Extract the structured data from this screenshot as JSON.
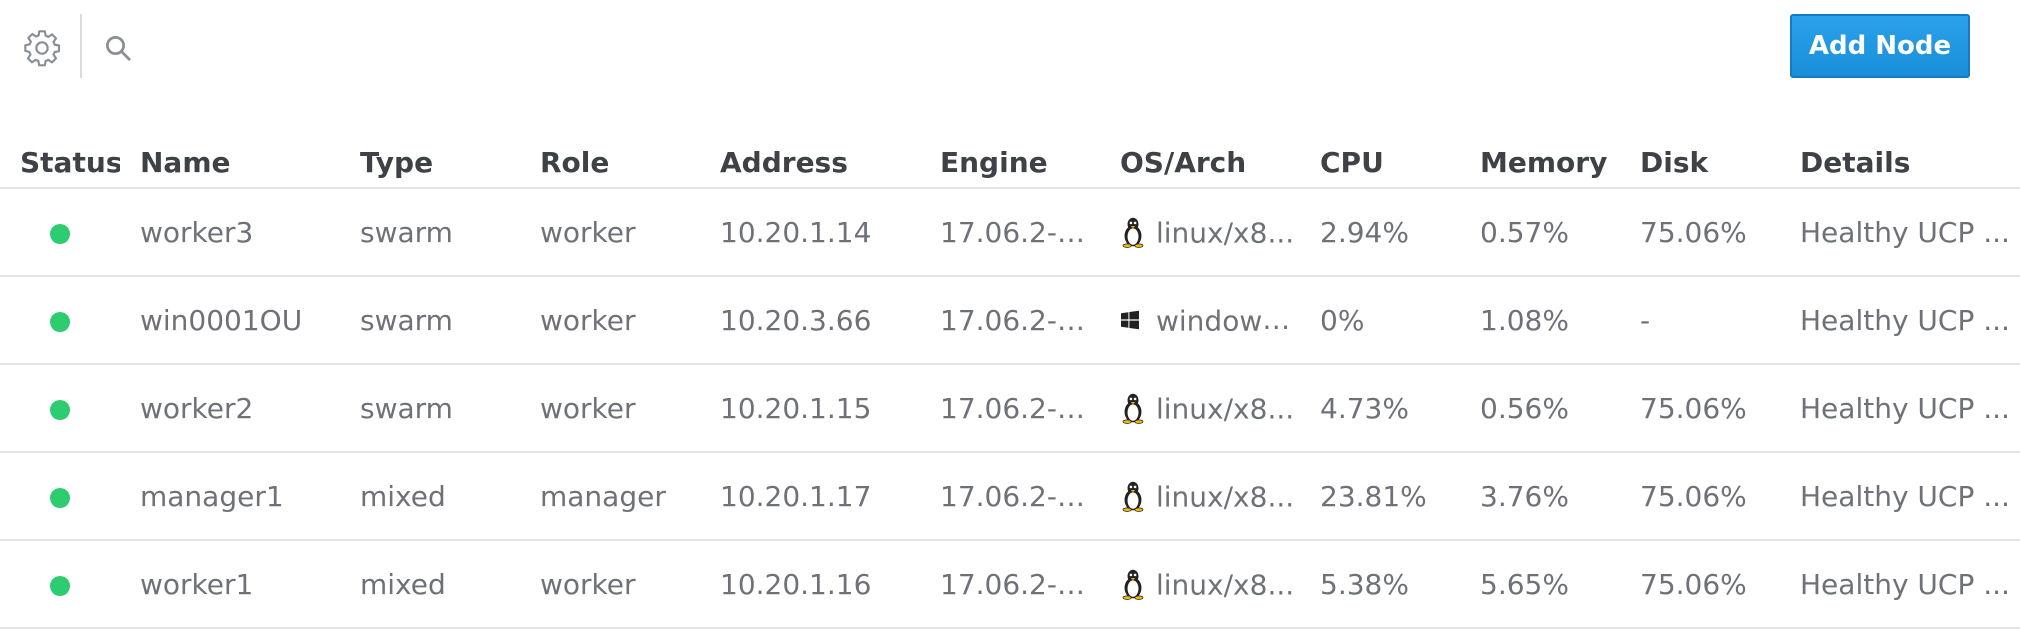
{
  "toolbar": {
    "settings_icon": "gear-icon",
    "search_icon": "search-icon",
    "add_button_label": "Add Node",
    "add_button_color": "#1b90da"
  },
  "table": {
    "columns": [
      "Status",
      "Name",
      "Type",
      "Role",
      "Address",
      "Engine",
      "OS/Arch",
      "CPU",
      "Memory",
      "Disk",
      "Details"
    ],
    "status_color": "#2ecc71",
    "rows": [
      {
        "status": "healthy",
        "name": "worker3",
        "type": "swarm",
        "role": "worker",
        "address": "10.20.1.14",
        "engine": "17.06.2-ee...",
        "os_icon": "linux-icon",
        "os": "linux/x8...",
        "cpu": "2.94%",
        "memory": "0.57%",
        "disk": "75.06%",
        "details": "Healthy UCP ..."
      },
      {
        "status": "healthy",
        "name": "win0001OU",
        "type": "swarm",
        "role": "worker",
        "address": "10.20.3.66",
        "engine": "17.06.2-ee...",
        "os_icon": "windows-icon",
        "os": "windows...",
        "cpu": "0%",
        "memory": "1.08%",
        "disk": "-",
        "details": "Healthy UCP ..."
      },
      {
        "status": "healthy",
        "name": "worker2",
        "type": "swarm",
        "role": "worker",
        "address": "10.20.1.15",
        "engine": "17.06.2-ee...",
        "os_icon": "linux-icon",
        "os": "linux/x8...",
        "cpu": "4.73%",
        "memory": "0.56%",
        "disk": "75.06%",
        "details": "Healthy UCP ..."
      },
      {
        "status": "healthy",
        "name": "manager1",
        "type": "mixed",
        "role": "manager",
        "address": "10.20.1.17",
        "engine": "17.06.2-ee...",
        "os_icon": "linux-icon",
        "os": "linux/x8...",
        "cpu": "23.81%",
        "memory": "3.76%",
        "disk": "75.06%",
        "details": "Healthy UCP ..."
      },
      {
        "status": "healthy",
        "name": "worker1",
        "type": "mixed",
        "role": "worker",
        "address": "10.20.1.16",
        "engine": "17.06.2-ee...",
        "os_icon": "linux-icon",
        "os": "linux/x8...",
        "cpu": "5.38%",
        "memory": "5.65%",
        "disk": "75.06%",
        "details": "Healthy UCP ..."
      }
    ]
  }
}
